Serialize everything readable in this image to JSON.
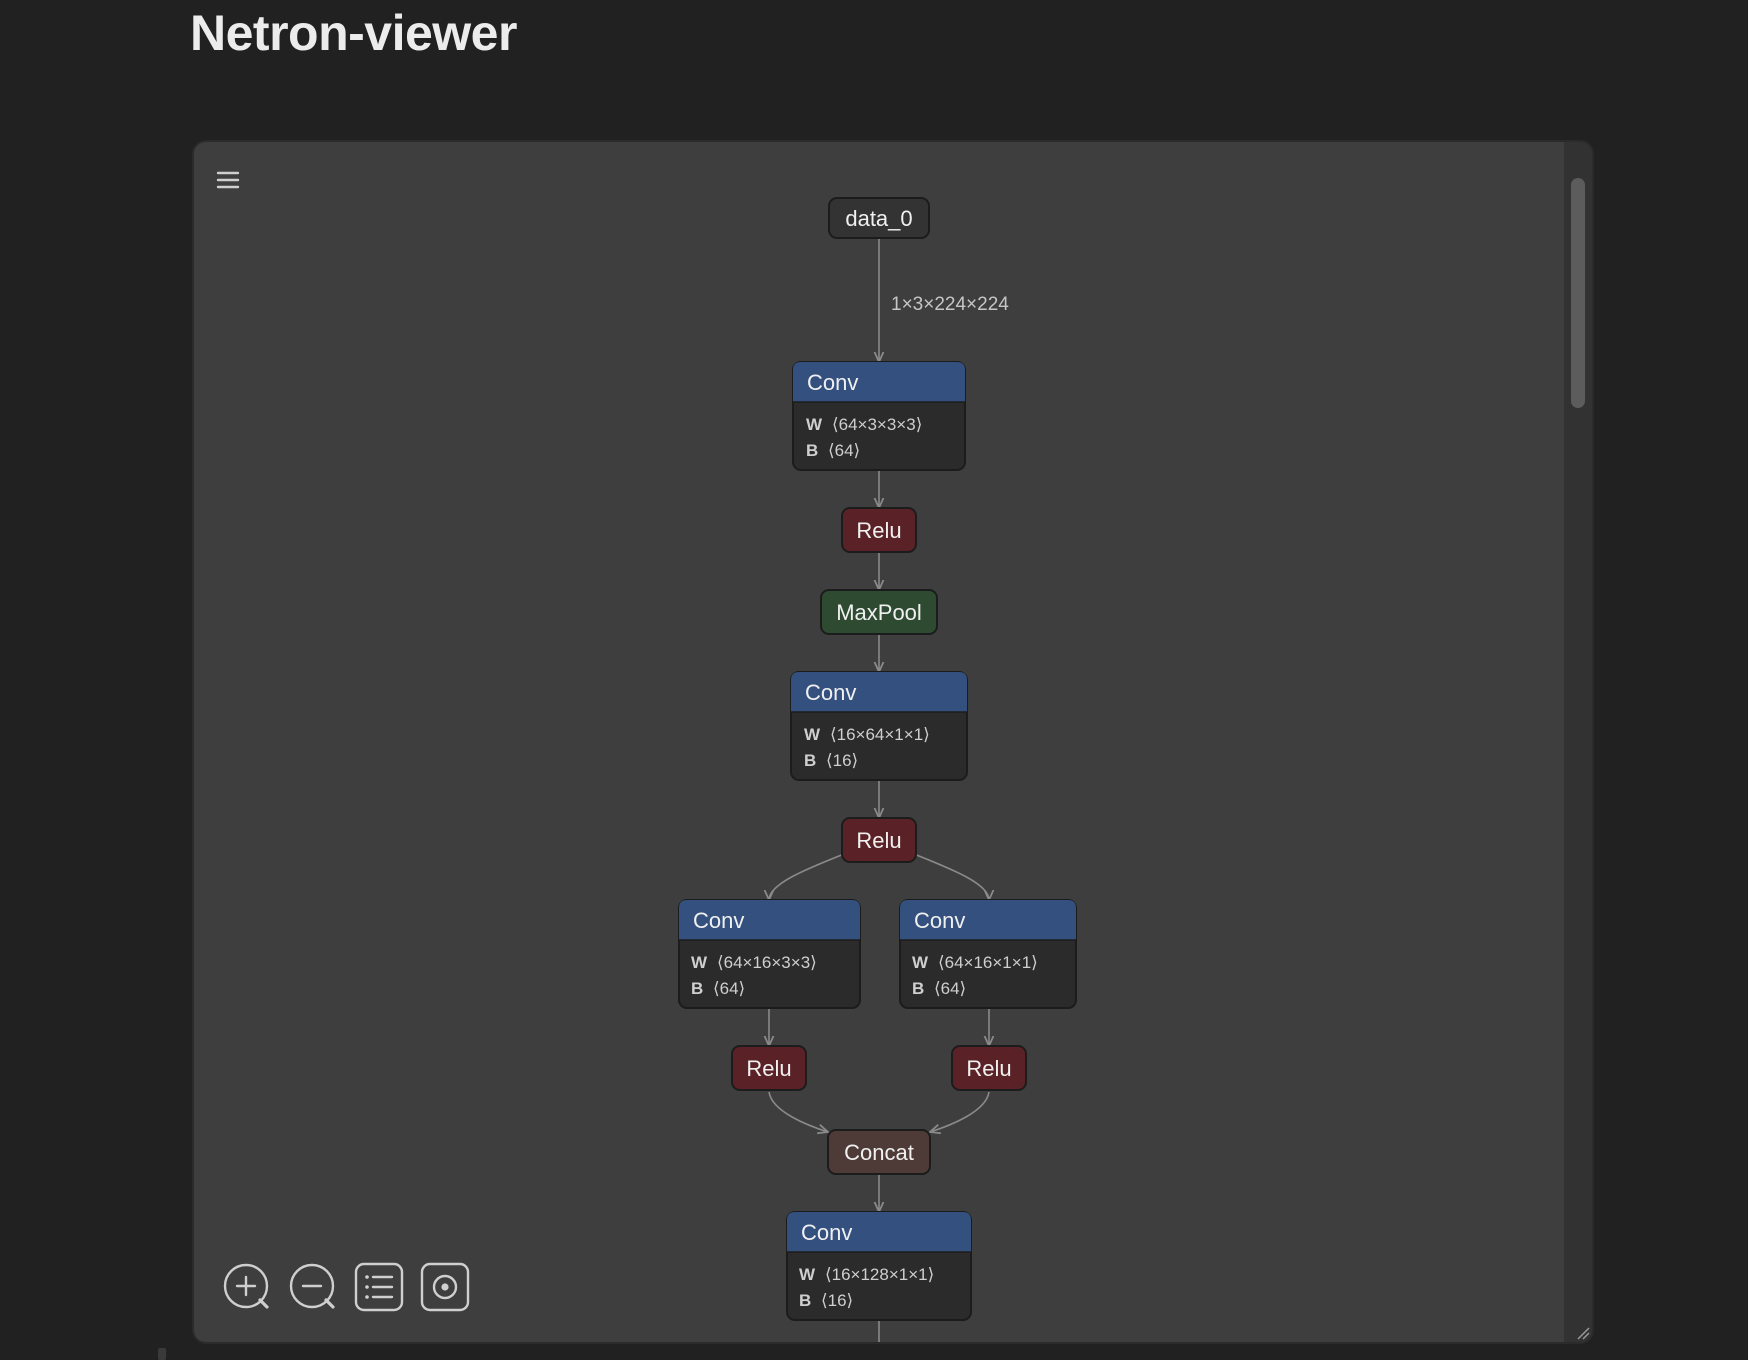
{
  "page": {
    "title": "Netron-viewer"
  },
  "toolbar": {
    "menu_icon": "hamburger-menu-icon",
    "buttons": [
      {
        "name": "zoom-in-button",
        "icon": "zoom-in-icon"
      },
      {
        "name": "zoom-out-button",
        "icon": "zoom-out-icon"
      },
      {
        "name": "list-view-button",
        "icon": "list-icon"
      },
      {
        "name": "fit-view-button",
        "icon": "target-icon"
      }
    ]
  },
  "colors": {
    "conv_header": "#34507f",
    "relu": "#5a2226",
    "maxpool": "#2e4b31",
    "concat": "#4e3b37",
    "input": "#333333",
    "attr_body": "#2b2b2b"
  },
  "graph": {
    "input": {
      "label": "data_0",
      "edge_label": "1×3×224×224"
    },
    "conv1": {
      "label": "Conv",
      "w_key": "W",
      "w_val": "⟨64×3×3×3⟩",
      "b_key": "B",
      "b_val": "⟨64⟩"
    },
    "relu1": {
      "label": "Relu"
    },
    "maxpool": {
      "label": "MaxPool"
    },
    "conv2": {
      "label": "Conv",
      "w_key": "W",
      "w_val": "⟨16×64×1×1⟩",
      "b_key": "B",
      "b_val": "⟨16⟩"
    },
    "relu2": {
      "label": "Relu"
    },
    "conv3": {
      "label": "Conv",
      "w_key": "W",
      "w_val": "⟨64×16×3×3⟩",
      "b_key": "B",
      "b_val": "⟨64⟩"
    },
    "conv4": {
      "label": "Conv",
      "w_key": "W",
      "w_val": "⟨64×16×1×1⟩",
      "b_key": "B",
      "b_val": "⟨64⟩"
    },
    "relu3": {
      "label": "Relu"
    },
    "relu4": {
      "label": "Relu"
    },
    "concat": {
      "label": "Concat"
    },
    "conv5": {
      "label": "Conv",
      "w_key": "W",
      "w_val": "⟨16×128×1×1⟩",
      "b_key": "B",
      "b_val": "⟨16⟩"
    }
  }
}
